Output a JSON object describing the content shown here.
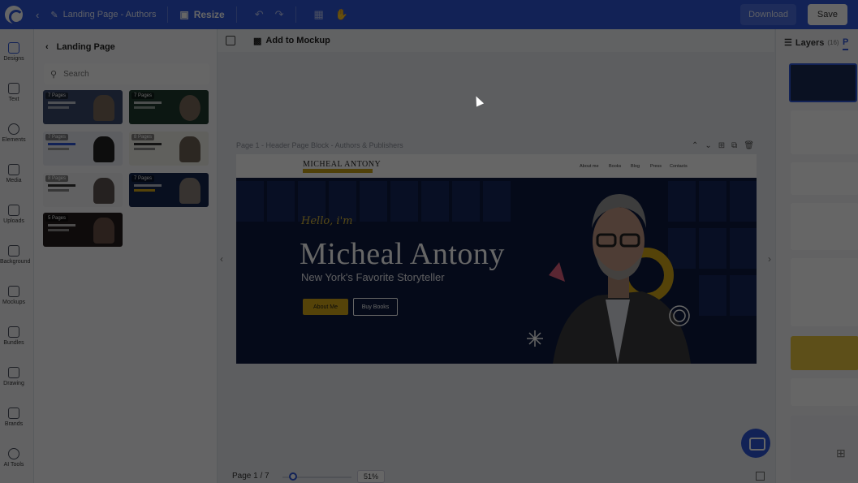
{
  "topbar": {
    "doc_title": "Landing Page - Authors &",
    "resize_label": "Resize",
    "download_label": "Download",
    "save_label": "Save"
  },
  "rail": {
    "items": [
      {
        "label": "Designs",
        "icon": "layout-icon"
      },
      {
        "label": "Text",
        "icon": "text-icon"
      },
      {
        "label": "Elements",
        "icon": "shapes-icon"
      },
      {
        "label": "Media",
        "icon": "image-icon"
      },
      {
        "label": "Uploads",
        "icon": "upload-icon"
      },
      {
        "label": "Background",
        "icon": "background-icon"
      },
      {
        "label": "Mockups",
        "icon": "mockup-icon"
      },
      {
        "label": "Bundles",
        "icon": "bundle-icon"
      },
      {
        "label": "Drawing",
        "icon": "pen-icon"
      },
      {
        "label": "Brands",
        "icon": "brand-icon"
      },
      {
        "label": "AI Tools",
        "icon": "sparkle-icon"
      }
    ]
  },
  "templates": {
    "title": "Landing Page",
    "search_placeholder": "Search",
    "items": [
      {
        "pages": "7 Pages",
        "color": "#3b4a6b"
      },
      {
        "pages": "7 Pages",
        "color": "#1f3a2e"
      },
      {
        "pages": "7 Pages",
        "color": "#e8eaf2"
      },
      {
        "pages": "8 Pages",
        "color": "#f1efe8"
      },
      {
        "pages": "8 Pages",
        "color": "#f2f3f5"
      },
      {
        "pages": "7 Pages",
        "color": "#16264f"
      },
      {
        "pages": "5 Pages",
        "color": "#241c1c"
      }
    ]
  },
  "canvas": {
    "add_to_mockup": "Add to Mockup",
    "page_label": "Page 1 - Header Page Block - Authors & Publishers",
    "page_count": "Page 1 / 7",
    "zoom": "51%",
    "zoom_fraction": 0.1
  },
  "design": {
    "brand": "MICHEAL ANTONY",
    "nav": [
      "About me",
      "Books",
      "Blog",
      "Press",
      "Contacts"
    ],
    "hello": "Hello, i'm",
    "name": "Micheal Antony",
    "tagline": "New York's Favorite Storyteller",
    "btn_about": "About Me",
    "btn_books": "Buy Books"
  },
  "layers_panel": {
    "title": "Layers",
    "count": "(16)",
    "pages_tab": "P"
  },
  "colors": {
    "accent": "#2f56d6",
    "hero_bg": "#0d1b3f",
    "gold": "#d4a817"
  }
}
